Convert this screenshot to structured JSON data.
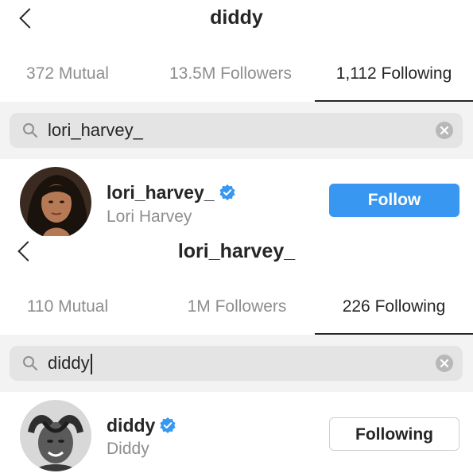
{
  "screens": [
    {
      "header": {
        "title": "diddy"
      },
      "tabs": [
        {
          "label": "372 Mutual",
          "active": false
        },
        {
          "label": "13.5M Followers",
          "active": false
        },
        {
          "label": "1,112 Following",
          "active": true
        }
      ],
      "search": {
        "query": "lori_harvey_"
      },
      "result": {
        "username": "lori_harvey_",
        "full_name": "Lori Harvey",
        "verified": true,
        "action_label": "Follow"
      }
    },
    {
      "header": {
        "title": "lori_harvey_"
      },
      "tabs": [
        {
          "label": "110 Mutual",
          "active": false
        },
        {
          "label": "1M Followers",
          "active": false
        },
        {
          "label": "226 Following",
          "active": true
        }
      ],
      "search": {
        "query": "diddy"
      },
      "result": {
        "username": "diddy",
        "full_name": "Diddy",
        "verified": true,
        "action_label": "Following"
      }
    }
  ],
  "colors": {
    "accent_blue": "#3897f0",
    "verified_blue": "#3897f0",
    "text_primary": "#262626",
    "text_secondary": "#8e8e8e",
    "search_bg": "#e4e4e4"
  },
  "icons": {
    "back": "chevron-left-icon",
    "search": "search-icon",
    "clear": "clear-icon",
    "verified": "verified-badge-icon"
  }
}
